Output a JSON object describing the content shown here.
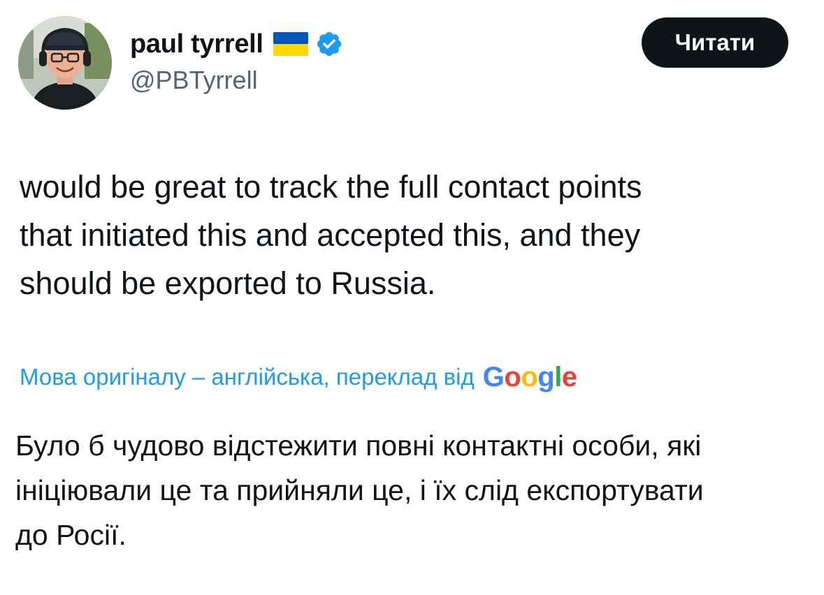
{
  "author": {
    "display_name": "paul tyrrell",
    "handle": "@PBTyrrell",
    "avatar": "profile-photo",
    "flag": "ukraine-flag-icon",
    "verified": "verified-badge-icon"
  },
  "header": {
    "read_button_label": "Читати"
  },
  "tweet": {
    "text": "would be great to track the full contact points\nthat initiated this and accepted this, and they\nshould be exported to Russia."
  },
  "translation": {
    "note": "Мова оригіналу – англійська, переклад від",
    "provider_logo_letters": [
      "G",
      "o",
      "o",
      "g",
      "l",
      "e"
    ],
    "text": "Було б чудово відстежити повні контактні особи, які\nініціювали це та прийняли це, і їх слід експортувати\nдо Росії."
  },
  "colors": {
    "accent": "#1d9bf0",
    "text": "#0f1419",
    "secondary": "#536471",
    "button_bg": "#0f1419",
    "google_blue": "#4285f4",
    "google_red": "#ea4335",
    "google_yellow": "#fbbc05",
    "google_green": "#34a853",
    "flag_blue": "#0057b7",
    "flag_yellow": "#ffd700"
  }
}
